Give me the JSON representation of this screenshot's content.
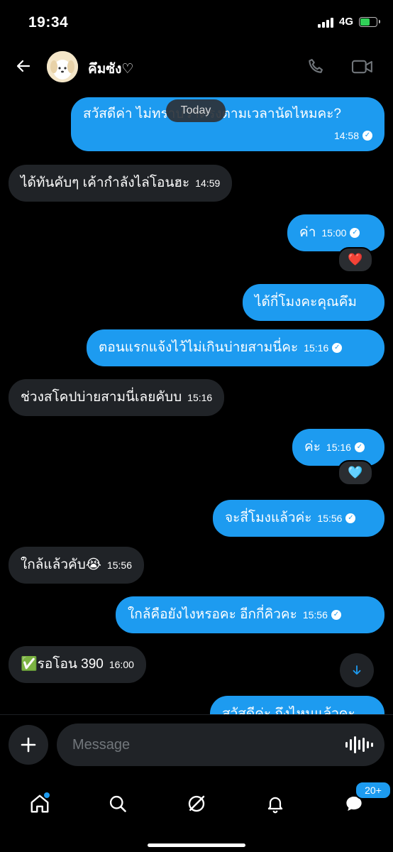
{
  "status_bar": {
    "time": "19:34",
    "network": "4G"
  },
  "header": {
    "contact_name": "คึมซัง♡"
  },
  "chat": {
    "date_pill": "Today",
    "messages": [
      {
        "dir": "out",
        "text": "สวัสดีค่า ไม่ทราบว่าตรงตามเวลานัดไหมคะ?",
        "time": "14:58",
        "read": true
      },
      {
        "dir": "in",
        "text": "ได้ทันคับๆ เค้ากำลังไล่โอนฮะ",
        "time": "14:59"
      },
      {
        "dir": "out",
        "text": "ค่า",
        "time": "15:00",
        "read": true,
        "reaction": "❤️"
      },
      {
        "dir": "out",
        "text": "ได้กี่โมงคะคุณคึม"
      },
      {
        "dir": "out",
        "text": "ตอนแรกแจ้งไว้ไม่เกินบ่ายสามนี่คะ",
        "time": "15:16",
        "read": true
      },
      {
        "dir": "in",
        "text": "ช่วงสโคปบ่ายสามนี่เลยคับบ",
        "time": "15:16"
      },
      {
        "dir": "out",
        "text": "ค่ะ",
        "time": "15:16",
        "read": true,
        "reaction": "🩵"
      },
      {
        "dir": "out",
        "text": "จะสี่โมงแล้วค่ะ",
        "time": "15:56",
        "read": true
      },
      {
        "dir": "in",
        "text": "ใกล้แล้วคับ😭",
        "time": "15:56"
      },
      {
        "dir": "out",
        "text": "ใกล้คือยังไงหรอคะ อีกกี่คิวคะ",
        "time": "15:56",
        "read": true
      },
      {
        "dir": "in",
        "text": "✅รอโอน 390",
        "time": "16:00"
      },
      {
        "dir": "out",
        "text": "สวัสดีค่ะ ถึงไหนแล้วคะ"
      }
    ]
  },
  "composer": {
    "placeholder": "Message"
  },
  "tabbar": {
    "messages_badge": "20+"
  },
  "colors": {
    "accent": "#1d9bf0",
    "incoming_bubble": "#202327",
    "background": "#000000"
  }
}
